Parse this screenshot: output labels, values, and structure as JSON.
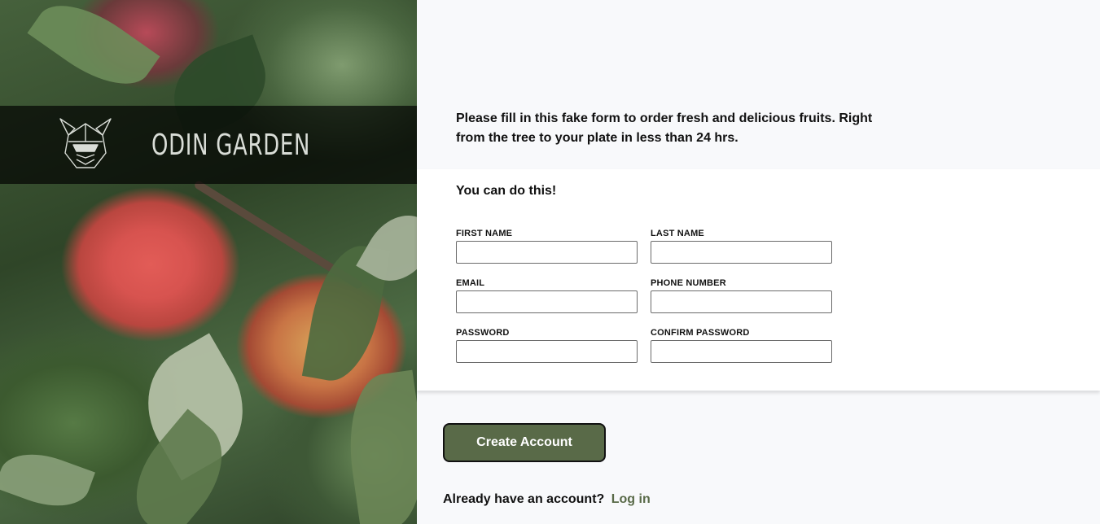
{
  "brand": {
    "name": "ODIN GARDEN",
    "logo_icon": "viking-helmet-icon"
  },
  "intro": {
    "text": "Please fill in this fake form to order fresh and delicious fruits. Right from the tree to your plate in less than 24 hrs."
  },
  "form": {
    "heading": "You can do this!",
    "fields": [
      {
        "label": "FIRST NAME",
        "value": ""
      },
      {
        "label": "LAST NAME",
        "value": ""
      },
      {
        "label": "EMAIL",
        "value": ""
      },
      {
        "label": "PHONE NUMBER",
        "value": ""
      },
      {
        "label": "PASSWORD",
        "value": ""
      },
      {
        "label": "CONFIRM PASSWORD",
        "value": ""
      }
    ]
  },
  "actions": {
    "create_account": "Create Account"
  },
  "login": {
    "prompt": "Already have an account?",
    "link": "Log in"
  },
  "colors": {
    "accent": "#596a48",
    "background": "#f8f9fb",
    "card": "#ffffff"
  }
}
